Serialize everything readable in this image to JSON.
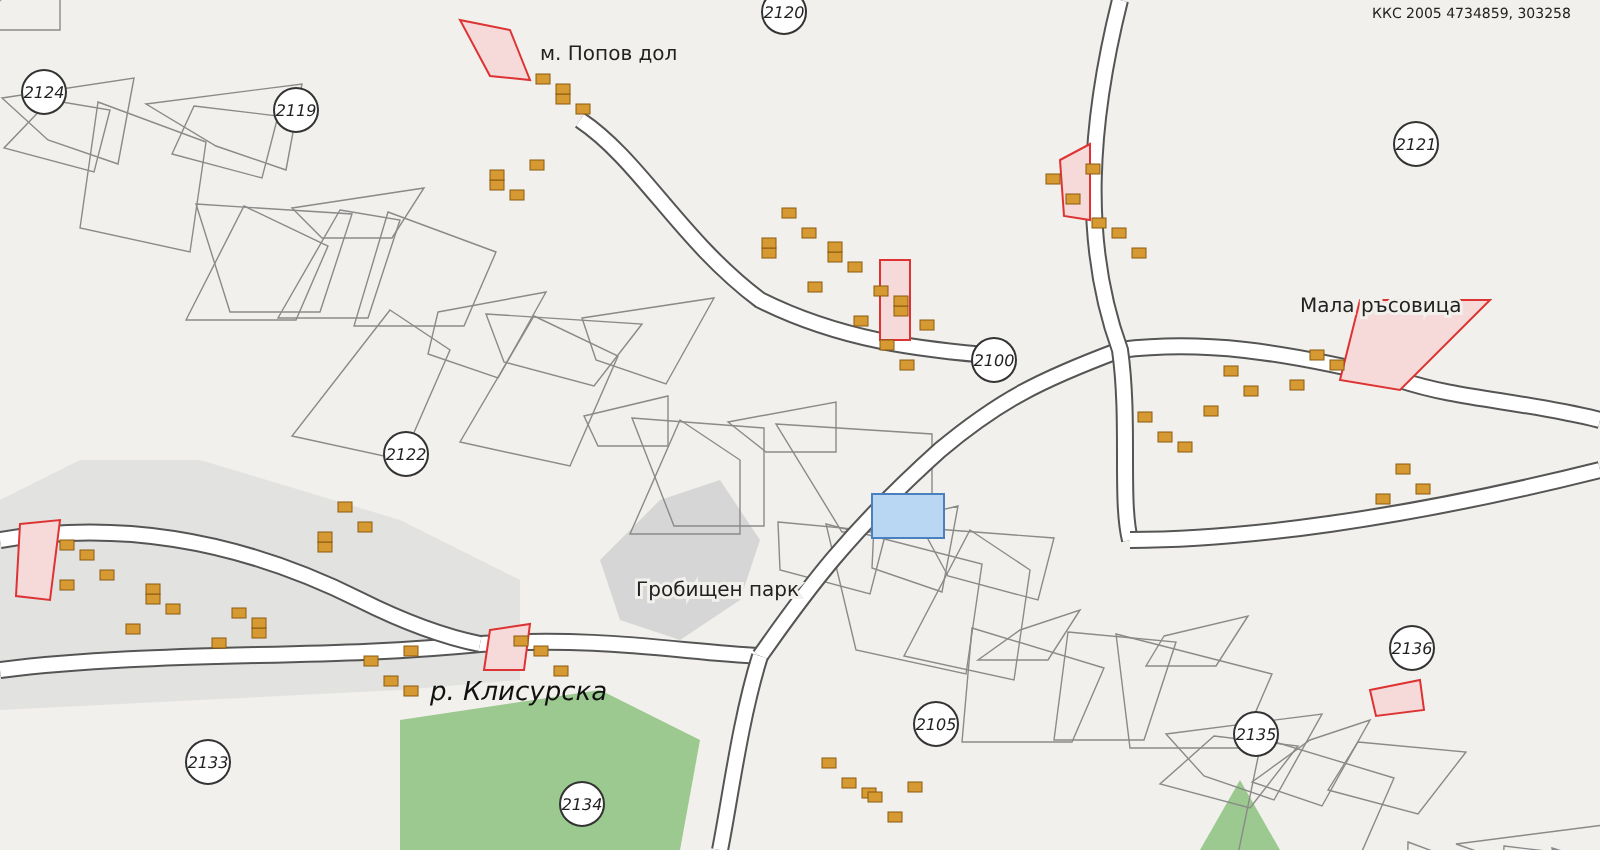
{
  "map": {
    "coordinates_note": "ККС 2005 4734859, 303258",
    "place_labels": [
      {
        "kind": "locality",
        "text": "м. Попов дол"
      },
      {
        "kind": "locality",
        "text": "Мала ръсовица"
      },
      {
        "kind": "area",
        "text": "Гробищен парк"
      },
      {
        "kind": "river",
        "text": "р. Клисурска"
      }
    ],
    "block_numbers": [
      "2120",
      "2124",
      "2119",
      "2121",
      "2122",
      "2100",
      "2105",
      "2133",
      "2134",
      "2135",
      "2136"
    ]
  }
}
